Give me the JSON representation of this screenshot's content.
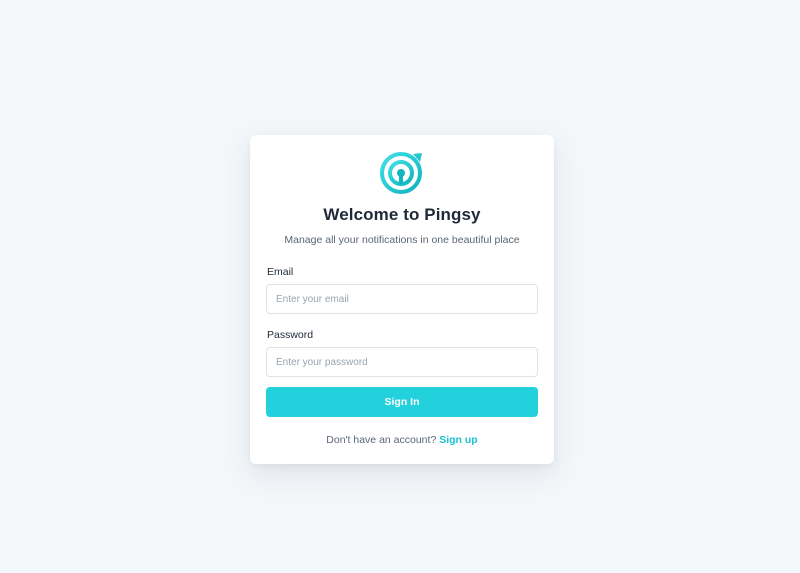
{
  "brand": {
    "logo_icon": "pingsy-target-logo-icon",
    "accent_color": "#22d1dc"
  },
  "login": {
    "title": "Welcome to Pingsy",
    "subtitle": "Manage all your notifications in one beautiful place",
    "email_label": "Email",
    "email_placeholder": "Enter your email",
    "email_value": "",
    "password_label": "Password",
    "password_placeholder": "Enter your password",
    "password_value": "",
    "submit_label": "Sign In",
    "footer_prompt": "Don't have an account?",
    "signup_label": "Sign up"
  }
}
